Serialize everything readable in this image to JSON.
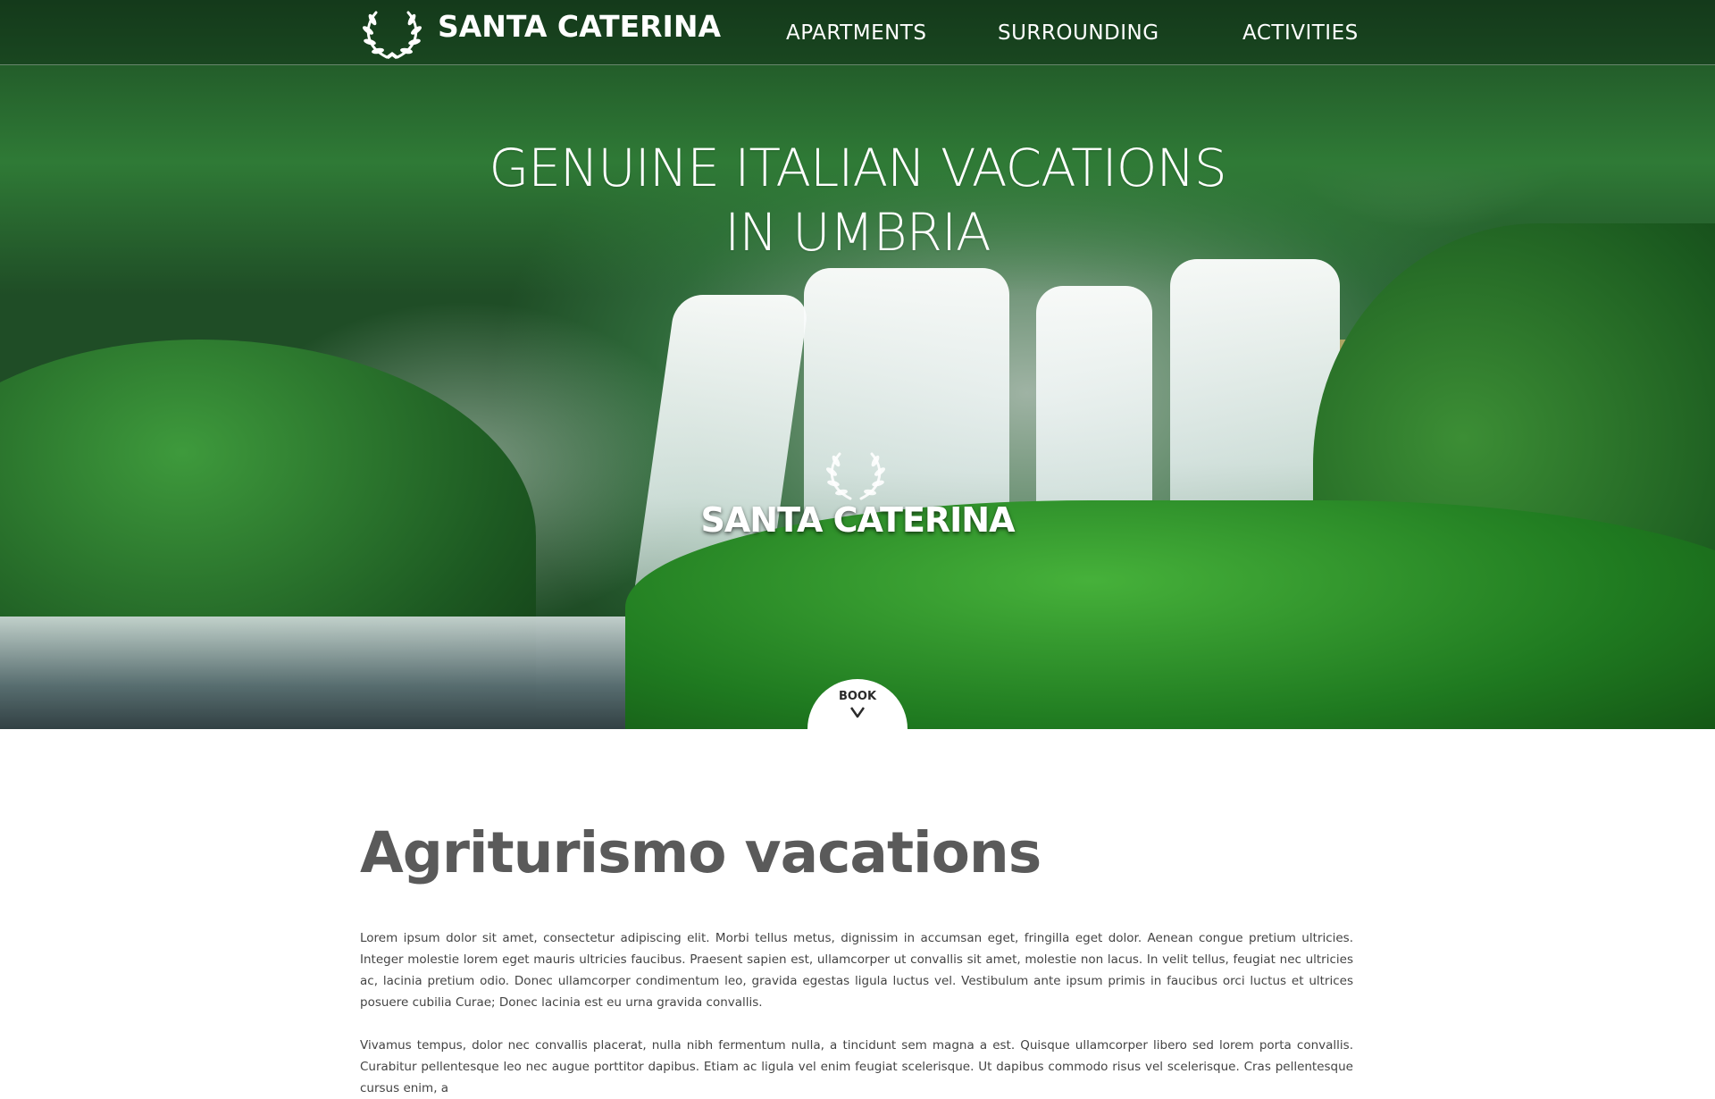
{
  "brand": {
    "name": "SANTA CATERINA"
  },
  "nav": {
    "items": [
      {
        "label": "APARTMENTS"
      },
      {
        "label": "SURROUNDING"
      },
      {
        "label": "ACTIVITIES"
      }
    ]
  },
  "hero": {
    "title_line1": "GENUINE ITALIAN VACATIONS",
    "title_line2": "IN UMBRIA",
    "center_brand": "SANTA CATERINA",
    "book_label": "BOOK",
    "book_icon": "chevron-down-icon"
  },
  "content": {
    "title": "Agriturismo vacations",
    "paragraphs": [
      "Lorem ipsum dolor sit amet, consectetur adipiscing elit. Morbi tellus metus, dignissim in accumsan eget, fringilla eget dolor. Aenean congue pretium ultricies. Integer molestie lorem eget mauris ultricies faucibus. Praesent sapien est, ullamcorper ut convallis sit amet, molestie non lacus. In velit tellus, feugiat nec ultricies ac, lacinia pretium odio. Donec ullamcorper condimentum leo, gravida egestas ligula luctus vel. Vestibulum ante ipsum primis in faucibus orci luctus et ultrices posuere cubilia Curae; Donec lacinia est eu urna gravida convallis.",
      "Vivamus tempus, dolor nec convallis placerat, nulla nibh fermentum nulla, a tincidunt sem magna a est. Quisque ullamcorper libero sed lorem porta convallis. Curabitur pellentesque leo nec augue porttitor dapibus. Etiam ac ligula vel enim feugiat scelerisque. Ut dapibus commodo risus vel scelerisque. Cras pellentesque cursus enim, a"
    ]
  },
  "colors": {
    "heading": "#5a5a5a",
    "body_text": "#444444",
    "nav_text": "#ffffff",
    "book_bg": "#ffffff"
  }
}
